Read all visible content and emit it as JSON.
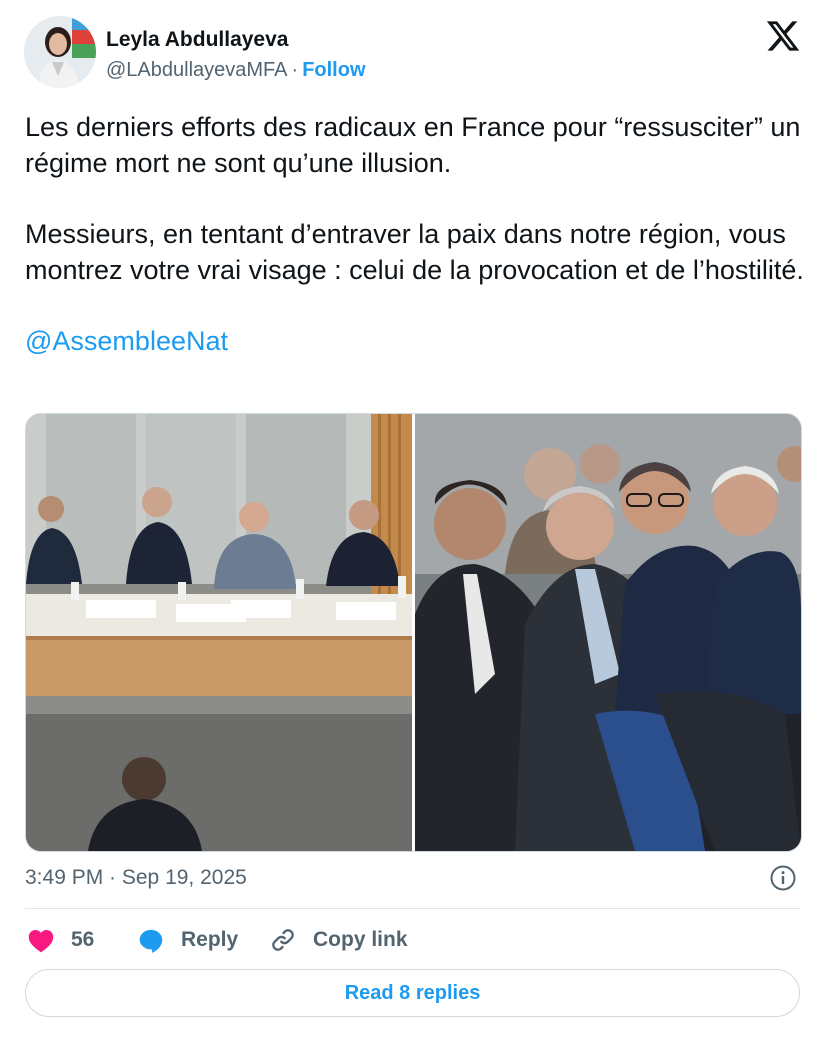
{
  "author": {
    "name": "Leyla Abdullayeva",
    "handle": "@LAbdullayevaMFA",
    "separator": "·",
    "follow_label": "Follow"
  },
  "tweet": {
    "paragraph1": "Les derniers efforts des radicaux en France pour “ressusciter” un régime mort ne sont qu’une illusion.",
    "paragraph2": "Messieurs, en tentant d’entraver la paix dans notre région, vous montrez votre vrai visage : celui de la provocation et de l’hostilité.",
    "mention": "@AssembleeNat"
  },
  "meta": {
    "timestamp": "3:49 PM · Sep 19, 2025"
  },
  "actions": {
    "like_count": "56",
    "reply_label": "Reply",
    "copy_link_label": "Copy link"
  },
  "read_replies_label": "Read 8 replies",
  "colors": {
    "accent": "#1d9bf0",
    "like": "#f91880",
    "text": "#0f1419",
    "muted": "#536471"
  }
}
